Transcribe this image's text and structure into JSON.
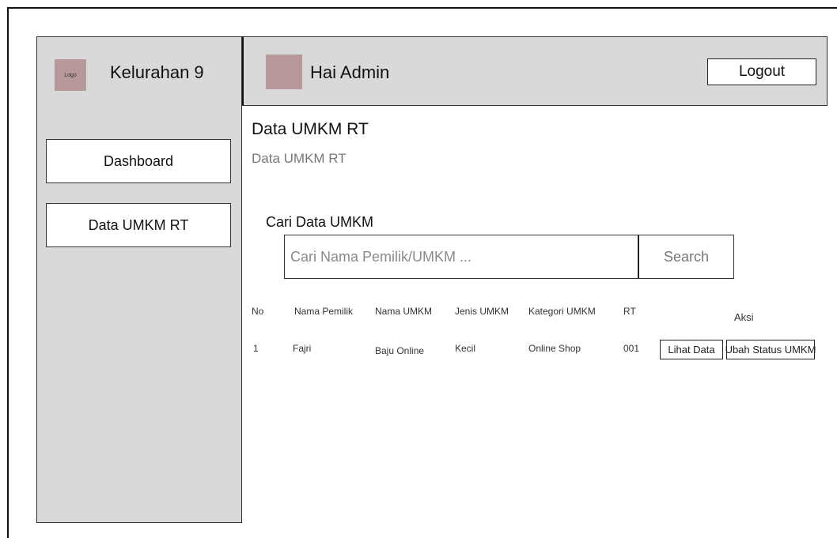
{
  "sidebar": {
    "logo_text": "Logo",
    "brand": "Kelurahan 9",
    "items": [
      {
        "label": "Dashboard"
      },
      {
        "label": "Data UMKM RT"
      }
    ]
  },
  "header": {
    "greeting": "Hai Admin",
    "logout_label": "Logout"
  },
  "main": {
    "title": "Data UMKM RT",
    "breadcrumb": "Data UMKM RT",
    "search": {
      "label": "Cari Data UMKM",
      "placeholder": "Cari Nama Pemilik/UMKM ...",
      "value": "",
      "button_label": "Search"
    },
    "table": {
      "columns": [
        "No",
        "Nama Pemilik",
        "Nama UMKM",
        "Jenis UMKM",
        "Kategori UMKM",
        "RT",
        "Aksi"
      ],
      "rows": [
        {
          "no": "1",
          "nama_pemilik": "Fajri",
          "nama_umkm": "Baju Online",
          "jenis_umkm": "Kecil",
          "kategori_umkm": "Online Shop",
          "rt": "001",
          "actions": [
            "Lihat Data",
            "Ubah Status UMKM"
          ]
        }
      ]
    }
  },
  "colors": {
    "panel_gray": "#d9d9d9",
    "placeholder_pink": "#b7999b"
  }
}
